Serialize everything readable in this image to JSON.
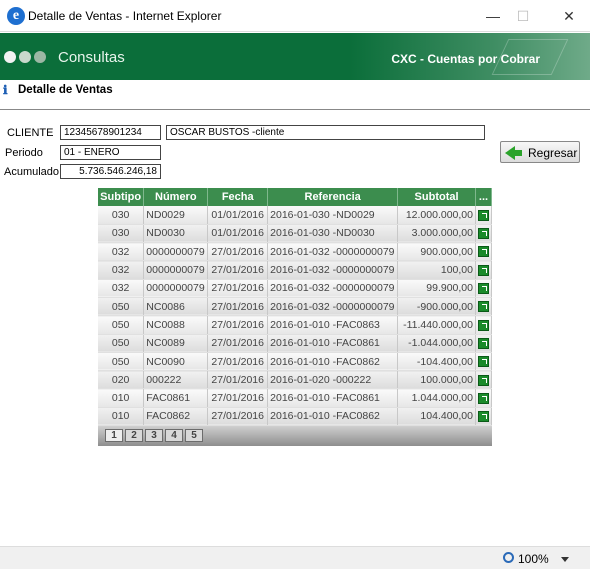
{
  "window": {
    "title": "Detalle de Ventas - Internet Explorer",
    "minimize": "—",
    "maximize": "☐",
    "close": "✕"
  },
  "banner": {
    "left_title": "Consultas",
    "right_title": "CXC - Cuentas por Cobrar"
  },
  "section": {
    "title": "Detalle de Ventas"
  },
  "form": {
    "cliente_label": "CLIENTE",
    "cliente_code": "12345678901234",
    "cliente_name": "OSCAR BUSTOS -cliente",
    "periodo_label": "Periodo",
    "periodo_value": "01 - ENERO",
    "acumulado_label": "Acumulado",
    "acumulado_value": "5.736.546.246,18",
    "regresar_label": "Regresar"
  },
  "table": {
    "headers": [
      "Subtipo",
      "Número",
      "Fecha",
      "Referencia",
      "Subtotal",
      "..."
    ],
    "rows": [
      [
        "030",
        "ND0029",
        "01/01/2016",
        "2016-01-030 -ND0029",
        "12.000.000,00"
      ],
      [
        "030",
        "ND0030",
        "01/01/2016",
        "2016-01-030 -ND0030",
        "3.000.000,00"
      ],
      [
        "032",
        "0000000079",
        "27/01/2016",
        "2016-01-032 -0000000079",
        "900.000,00"
      ],
      [
        "032",
        "0000000079",
        "27/01/2016",
        "2016-01-032 -0000000079",
        "100,00"
      ],
      [
        "032",
        "0000000079",
        "27/01/2016",
        "2016-01-032 -0000000079",
        "99.900,00"
      ],
      [
        "050",
        "NC0086",
        "27/01/2016",
        "2016-01-032 -0000000079",
        "-900.000,00"
      ],
      [
        "050",
        "NC0088",
        "27/01/2016",
        "2016-01-010 -FAC0863",
        "-11.440.000,00"
      ],
      [
        "050",
        "NC0089",
        "27/01/2016",
        "2016-01-010 -FAC0861",
        "-1.044.000,00"
      ],
      [
        "050",
        "NC0090",
        "27/01/2016",
        "2016-01-010 -FAC0862",
        "-104.400,00"
      ],
      [
        "020",
        "000222",
        "27/01/2016",
        "2016-01-020 -000222",
        "100.000,00"
      ],
      [
        "010",
        "FAC0861",
        "27/01/2016",
        "2016-01-010 -FAC0861",
        "1.044.000,00"
      ],
      [
        "010",
        "FAC0862",
        "27/01/2016",
        "2016-01-010 -FAC0862",
        "104.400,00"
      ]
    ]
  },
  "pager": {
    "pages": [
      "1",
      "2",
      "3",
      "4",
      "5"
    ],
    "current": "1"
  },
  "status": {
    "zoom": "100%"
  },
  "colors": {
    "banner": "#0b6e3a",
    "header": "#3c8d4e",
    "accent": "#2aa32a"
  }
}
